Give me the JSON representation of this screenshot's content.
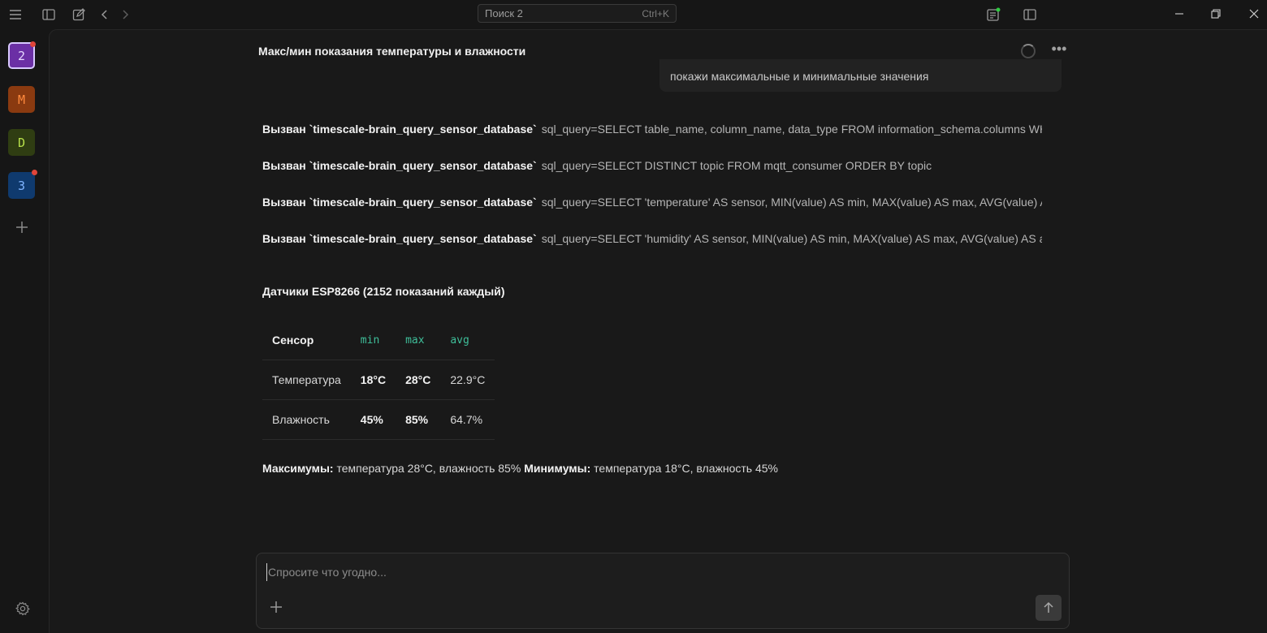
{
  "topbar": {
    "search_label": "Поиск 2",
    "search_shortcut": "Ctrl+K"
  },
  "workspaces": [
    {
      "label": "2",
      "color": "#6b2fa5",
      "text_color": "#e6d8ff",
      "active": true,
      "badge": true
    },
    {
      "label": "M",
      "color": "#8a3a10",
      "text_color": "#ff8a3d",
      "badge": false
    },
    {
      "label": "D",
      "color": "#2f3d12",
      "text_color": "#b7e04a",
      "badge": false
    },
    {
      "label": "3",
      "color": "#0f3a6e",
      "text_color": "#7fb4ff",
      "badge": true
    }
  ],
  "chat": {
    "title": "Макс/мин показания температуры и влажности",
    "user_message": "покажи максимальные и минимальные значения",
    "tool_calls": [
      {
        "label": "Вызван `timescale-brain_query_sensor_database`",
        "args": "sql_query=SELECT table_name, column_name, data_type FROM information_schema.columns WH..."
      },
      {
        "label": "Вызван `timescale-brain_query_sensor_database`",
        "args": "sql_query=SELECT DISTINCT topic FROM mqtt_consumer ORDER BY topic"
      },
      {
        "label": "Вызван `timescale-brain_query_sensor_database`",
        "args": "sql_query=SELECT 'temperature' AS sensor, MIN(value) AS min, MAX(value) AS max, AVG(value) A..."
      },
      {
        "label": "Вызван `timescale-brain_query_sensor_database`",
        "args": "sql_query=SELECT 'humidity' AS sensor, MIN(value) AS min, MAX(value) AS max, AVG(value) AS av..."
      }
    ],
    "section_title": "Датчики ESP8266 (2152 показаний каждый)",
    "table": {
      "headers": [
        "Сенсор",
        "min",
        "max",
        "avg"
      ],
      "rows": [
        [
          "Температура",
          "18°C",
          "28°C",
          "22.9°C"
        ],
        [
          "Влажность",
          "45%",
          "85%",
          "64.7%"
        ]
      ]
    },
    "summary": {
      "max_label": "Максимумы:",
      "max_text": " температура 28°C, влажность 85% ",
      "min_label": "Минимумы:",
      "min_text": " температура 18°C, влажность 45%"
    }
  },
  "composer": {
    "placeholder": "Спросите что угодно..."
  },
  "colors": {
    "code_header": "#3fbf9a",
    "badge": "#e0453a"
  }
}
